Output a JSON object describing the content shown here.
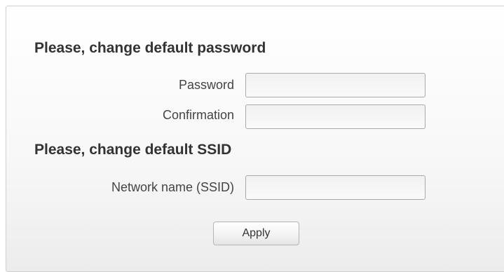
{
  "password_section": {
    "title": "Please, change default password",
    "password_label": "Password",
    "password_value": "",
    "confirmation_label": "Confirmation",
    "confirmation_value": ""
  },
  "ssid_section": {
    "title": "Please, change default SSID",
    "ssid_label": "Network name (SSID)",
    "ssid_value": ""
  },
  "actions": {
    "apply_label": "Apply"
  }
}
